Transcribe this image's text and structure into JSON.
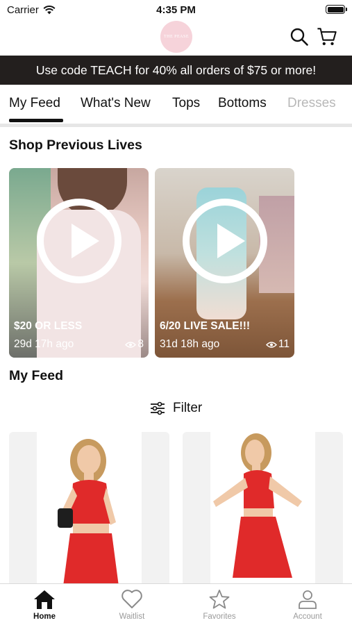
{
  "status_bar": {
    "carrier": "Carrier",
    "time": "4:35 PM"
  },
  "header": {
    "logo_text": "THE PEASE",
    "icons": [
      "search-icon",
      "cart-icon"
    ]
  },
  "promo_banner": {
    "text": "Use code TEACH for 40% all orders of $75 or more!"
  },
  "category_tabs": [
    {
      "label": "My Feed",
      "active": true
    },
    {
      "label": "What's New"
    },
    {
      "label": "Tops"
    },
    {
      "label": "Bottoms"
    },
    {
      "label": "Dresses"
    }
  ],
  "previous_lives": {
    "title": "Shop Previous Lives",
    "items": [
      {
        "title": "$20 OR LESS",
        "ago": "29d 17h ago",
        "views": "8"
      },
      {
        "title": "6/20 LIVE SALE!!!",
        "ago": "31d 18h ago",
        "views": "11"
      }
    ]
  },
  "feed": {
    "title": "My Feed",
    "filter_label": "Filter"
  },
  "colors": {
    "promo_bg": "#231f1e",
    "accent_red": "#e02a2a"
  },
  "bottom_nav": [
    {
      "label": "Home",
      "icon": "home-icon",
      "active": true
    },
    {
      "label": "Waitlist",
      "icon": "heart-icon"
    },
    {
      "label": "Favorites",
      "icon": "star-icon"
    },
    {
      "label": "Account",
      "icon": "person-icon"
    }
  ]
}
